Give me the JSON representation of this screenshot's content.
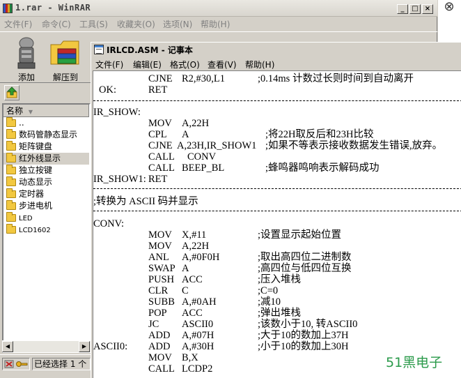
{
  "winrar": {
    "title": "1.rar - WinRAR",
    "controls": {
      "minimize": "_",
      "maximize": "□",
      "close": "×"
    },
    "menu": [
      "文件(F)",
      "命令(C)",
      "工具(S)",
      "收藏夹(O)",
      "选项(N)",
      "帮助(H)"
    ],
    "toolbar": {
      "add_label": "添加",
      "extract_label": "解压到"
    },
    "list": {
      "column_name": "名称",
      "items": [
        {
          "label": ".."
        },
        {
          "label": "数码管静态显示"
        },
        {
          "label": "矩阵键盘"
        },
        {
          "label": "红外线显示"
        },
        {
          "label": "独立按键"
        },
        {
          "label": "动态显示"
        },
        {
          "label": "定时器"
        },
        {
          "label": "步进电机"
        },
        {
          "label": "LED"
        },
        {
          "label": "LCD1602"
        }
      ]
    },
    "status": {
      "text": "已经选择 1 个"
    }
  },
  "right_strip": {
    "close_glyph": "⊗"
  },
  "notepad": {
    "title": "IRLCD.ASM - 记事本",
    "menu": [
      "文件(F)",
      "编辑(E)",
      "格式(O)",
      "查看(V)",
      "帮助(H)"
    ],
    "code": {
      "l01": {
        "op": "CJNE",
        "args": "R2,#30,L1",
        "comment": ";0.14ms 计数过长则时间到自动离开"
      },
      "l02": {
        "label": "OK:",
        "op": "RET"
      },
      "l03": {
        "label": "IR_SHOW:"
      },
      "l04": {
        "op": "MOV",
        "args": "A,22H"
      },
      "l05": {
        "op": "CPL",
        "args": "A",
        "comment": ";将22H取反后和23H比较"
      },
      "l06": {
        "op": "CJNE",
        "args": "A,23H,IR_SHOW1",
        "comment": ";如果不等表示接收数据发生错误,放弃。"
      },
      "l07": {
        "op": "CALL",
        "args": "CONV"
      },
      "l08": {
        "op": "CALL",
        "args": "BEEP_BL",
        "comment": ";蜂鸣器鸣响表示解码成功"
      },
      "l09": {
        "label": "IR_SHOW1:",
        "op": "RET"
      },
      "l10": {
        "label": ";转换为 ASCII 码并显示"
      },
      "l11": {
        "label": "CONV:"
      },
      "l12": {
        "op": "MOV",
        "args": "X,#11",
        "comment": ";设置显示起始位置"
      },
      "l13": {
        "op": "MOV",
        "args": "A,22H"
      },
      "l14": {
        "op": "ANL",
        "args": "A,#0F0H",
        "comment": ";取出高四位二进制数"
      },
      "l15": {
        "op": "SWAP",
        "args": "A",
        "comment": ";高四位与低四位互换"
      },
      "l16": {
        "op": "PUSH",
        "args": "ACC",
        "comment": ";压入堆栈"
      },
      "l17": {
        "op": "CLR",
        "args": "C",
        "comment": ";C=0"
      },
      "l18": {
        "op": "SUBB",
        "args": "A,#0AH",
        "comment": ";减10"
      },
      "l19": {
        "op": "POP",
        "args": "ACC",
        "comment": ";弹出堆栈"
      },
      "l20": {
        "op": "JC",
        "args": "ASCII0",
        "comment": ";该数小于10, 转ASCII0"
      },
      "l21": {
        "op": "ADD",
        "args": "A,#07H",
        "comment": ";大于10的数加上37H"
      },
      "l22": {
        "label": "ASCII0:",
        "op": "ADD",
        "args": "A,#30H",
        "comment": ";小于10的数加上30H"
      },
      "l23": {
        "op": "MOV",
        "args": "B,X"
      },
      "l24": {
        "op": "CALL",
        "args": "LCDP2"
      }
    }
  },
  "watermark": "51黑电子"
}
